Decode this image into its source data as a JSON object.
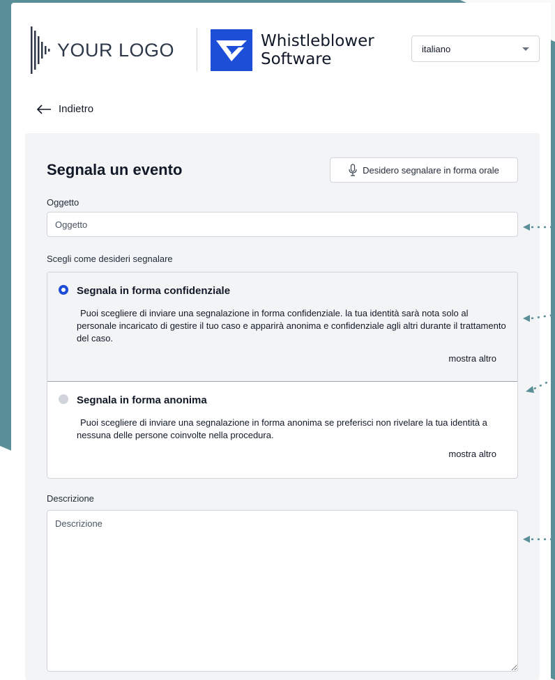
{
  "header": {
    "logo_text": "YOUR LOGO",
    "brand_line1": "Whistleblower",
    "brand_line2": "Software",
    "language": "italiano"
  },
  "nav": {
    "back_label": "Indietro"
  },
  "form": {
    "title": "Segnala un evento",
    "oral_button": "Desidero segnalare in forma orale",
    "subject_label": "Oggetto",
    "subject_placeholder": "Oggetto",
    "mode_label": "Scegli come desideri segnalare",
    "options": [
      {
        "title": "Segnala in forma confidenziale",
        "description": "Puoi scegliere di inviare una segnalazione in forma confidenziale. la tua identità sarà nota solo al personale incaricato di gestire il tuo caso e apparirà anonima e confidenziale agli altri durante il trattamento del caso.",
        "more": "mostra altro",
        "selected": true
      },
      {
        "title": "Segnala in forma anonima",
        "description": "Puoi scegliere di inviare una segnalazione in forma anonima se preferisci non rivelare la tua identità a nessuna delle persone coinvolte nella procedura.",
        "more": "mostra altro",
        "selected": false
      }
    ],
    "description_label": "Descrizione",
    "description_placeholder": "Descrizione"
  },
  "colors": {
    "teal": "#5b8f98",
    "brand_blue": "#1d4ed8",
    "panel_bg": "#f3f4f6"
  }
}
